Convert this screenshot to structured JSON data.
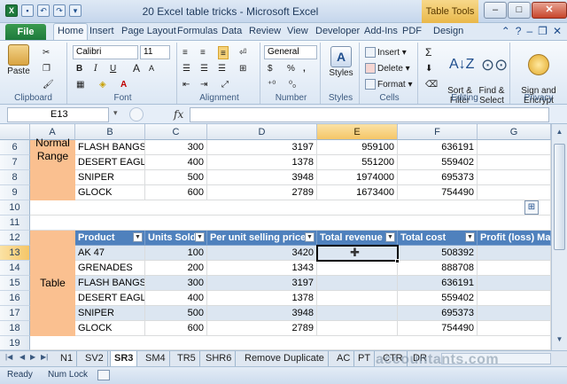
{
  "window": {
    "title": "20 Excel table tricks  -  Microsoft Excel",
    "context_tab": "Table Tools",
    "controls": {
      "minimize": "–",
      "maximize": "□",
      "close": "✕"
    }
  },
  "ribbon_tabs": [
    "File",
    "Home",
    "Insert",
    "Page Layout",
    "Formulas",
    "Data",
    "Review",
    "View",
    "Developer",
    "Add-Ins",
    "PDF",
    "Design"
  ],
  "active_tab": "Home",
  "ribbon": {
    "clipboard": {
      "label": "Clipboard",
      "paste": "Paste"
    },
    "font": {
      "label": "Font",
      "family": "Calibri",
      "size": "11",
      "bold": "B",
      "italic": "I",
      "underline": "U",
      "grow": "A",
      "shrink": "A",
      "font_color": "A"
    },
    "alignment": {
      "label": "Alignment"
    },
    "number": {
      "label": "Number",
      "format": "General",
      "currency": "$",
      "percent": "%",
      "comma": ","
    },
    "styles": {
      "label": "Styles",
      "button": "Styles"
    },
    "cells": {
      "label": "Cells",
      "insert": "Insert",
      "delete": "Delete",
      "format": "Format"
    },
    "editing": {
      "label": "Editing",
      "sort_filter": "Sort &\nFilter",
      "find_select": "Find &\nSelect",
      "sigma": "Σ"
    },
    "privacy": {
      "label": "Privacy",
      "sign_encrypt": "Sign and\nEncrypt"
    }
  },
  "formula_bar": {
    "name_box": "E13",
    "fx": "fx",
    "formula": ""
  },
  "columns": [
    "A",
    "B",
    "C",
    "D",
    "E",
    "F",
    "G"
  ],
  "selected_column": "E",
  "rows": [
    "6",
    "7",
    "8",
    "9",
    "10",
    "11",
    "12",
    "13",
    "14",
    "15",
    "16",
    "17",
    "18",
    "19"
  ],
  "selected_row": "13",
  "group_labels": {
    "top": "Normal\nRange",
    "bottom": "Table"
  },
  "range_rows": [
    {
      "product": "FLASH BANGS",
      "units": "300",
      "price": "3197",
      "revenue": "959100",
      "cost": "636191"
    },
    {
      "product": "DESERT EAGLE",
      "units": "400",
      "price": "1378",
      "revenue": "551200",
      "cost": "559402"
    },
    {
      "product": "SNIPER",
      "units": "500",
      "price": "3948",
      "revenue": "1974000",
      "cost": "695373"
    },
    {
      "product": "GLOCK",
      "units": "600",
      "price": "2789",
      "revenue": "1673400",
      "cost": "754490"
    }
  ],
  "table_headers": [
    "Product",
    "Units Sold",
    "Per unit selling price",
    "Total revenue",
    "Total cost",
    "Profit (loss) Ma"
  ],
  "table_rows": [
    {
      "product": "AK 47",
      "units": "100",
      "price": "3420",
      "revenue": "",
      "cost": "508392"
    },
    {
      "product": "GRENADES",
      "units": "200",
      "price": "1343",
      "revenue": "",
      "cost": "888708"
    },
    {
      "product": "FLASH BANGS",
      "units": "300",
      "price": "3197",
      "revenue": "",
      "cost": "636191"
    },
    {
      "product": "DESERT EAGLE",
      "units": "400",
      "price": "1378",
      "revenue": "",
      "cost": "559402"
    },
    {
      "product": "SNIPER",
      "units": "500",
      "price": "3948",
      "revenue": "",
      "cost": "695373"
    },
    {
      "product": "GLOCK",
      "units": "600",
      "price": "2789",
      "revenue": "",
      "cost": "754490"
    }
  ],
  "sheet_tabs": [
    "N1",
    "SV2",
    "SR3",
    "SM4",
    "TR5",
    "SHR6",
    "Remove Duplicate",
    "AC",
    "PT",
    "CTR",
    "DR"
  ],
  "active_sheet": "SR3",
  "status": {
    "ready": "Ready",
    "num_lock": "Num Lock"
  },
  "watermark": "accountants.com"
}
